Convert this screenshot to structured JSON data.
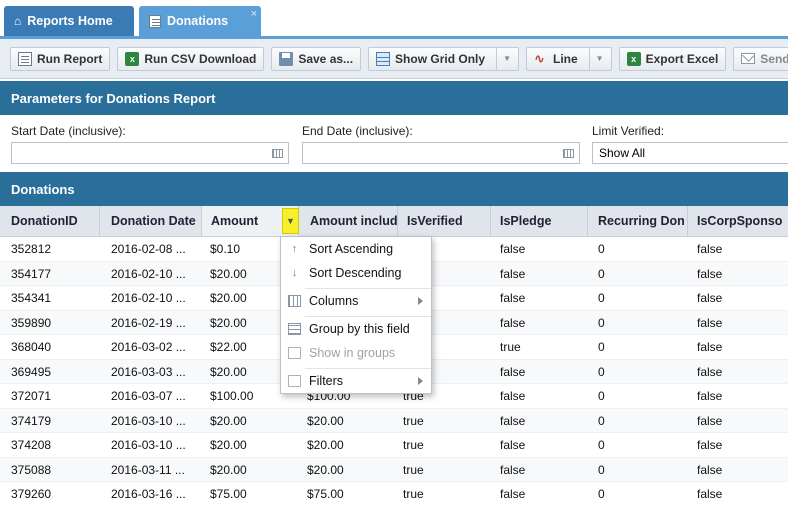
{
  "tabs": {
    "home": "Reports Home",
    "donations": "Donations",
    "close_glyph": "×"
  },
  "toolbar": {
    "run_report": "Run Report",
    "run_csv": "Run CSV Download",
    "save_as": "Save as...",
    "show_grid_only": "Show Grid Only",
    "line": "Line",
    "export_excel": "Export Excel",
    "send_email": "Send Em"
  },
  "parameters": {
    "title": "Parameters for Donations Report",
    "start_label": "Start Date (inclusive):",
    "start_value": "",
    "end_label": "End Date (inclusive):",
    "end_value": "",
    "limit_label": "Limit Verified:",
    "limit_value": "Show All"
  },
  "grid": {
    "title": "Donations",
    "columns": [
      "DonationID",
      "Donation Date",
      "Amount",
      "Amount includ",
      "IsVerified",
      "IsPledge",
      "Recurring Don",
      "IsCorpSponso"
    ],
    "rows": [
      [
        "352812",
        "2016-02-08 ...",
        "$0.10",
        "",
        "",
        "false",
        "0",
        "false"
      ],
      [
        "354177",
        "2016-02-10 ...",
        "$20.00",
        "",
        "",
        "false",
        "0",
        "false"
      ],
      [
        "354341",
        "2016-02-10 ...",
        "$20.00",
        "",
        "",
        "false",
        "0",
        "false"
      ],
      [
        "359890",
        "2016-02-19 ...",
        "$20.00",
        "",
        "",
        "false",
        "0",
        "false"
      ],
      [
        "368040",
        "2016-03-02 ...",
        "$22.00",
        "",
        "",
        "true",
        "0",
        "false"
      ],
      [
        "369495",
        "2016-03-03 ...",
        "$20.00",
        "",
        "",
        "false",
        "0",
        "false"
      ],
      [
        "372071",
        "2016-03-07 ...",
        "$100.00",
        "$100.00",
        "true",
        "false",
        "0",
        "false"
      ],
      [
        "374179",
        "2016-03-10 ...",
        "$20.00",
        "$20.00",
        "true",
        "false",
        "0",
        "false"
      ],
      [
        "374208",
        "2016-03-10 ...",
        "$20.00",
        "$20.00",
        "true",
        "false",
        "0",
        "false"
      ],
      [
        "375088",
        "2016-03-11 ...",
        "$20.00",
        "$20.00",
        "true",
        "false",
        "0",
        "false"
      ],
      [
        "379260",
        "2016-03-16 ...",
        "$75.00",
        "$75.00",
        "true",
        "false",
        "0",
        "false"
      ]
    ]
  },
  "column_menu": {
    "sort_asc": "Sort Ascending",
    "sort_desc": "Sort Descending",
    "columns": "Columns",
    "group_by": "Group by this field",
    "show_in_groups": "Show in groups",
    "filters": "Filters"
  },
  "colors": {
    "tab_home": "#3a7ab5",
    "tab_active": "#5b9fd8",
    "section_header": "#2a6f99",
    "menu_trigger_highlight": "#f7ef2a"
  }
}
